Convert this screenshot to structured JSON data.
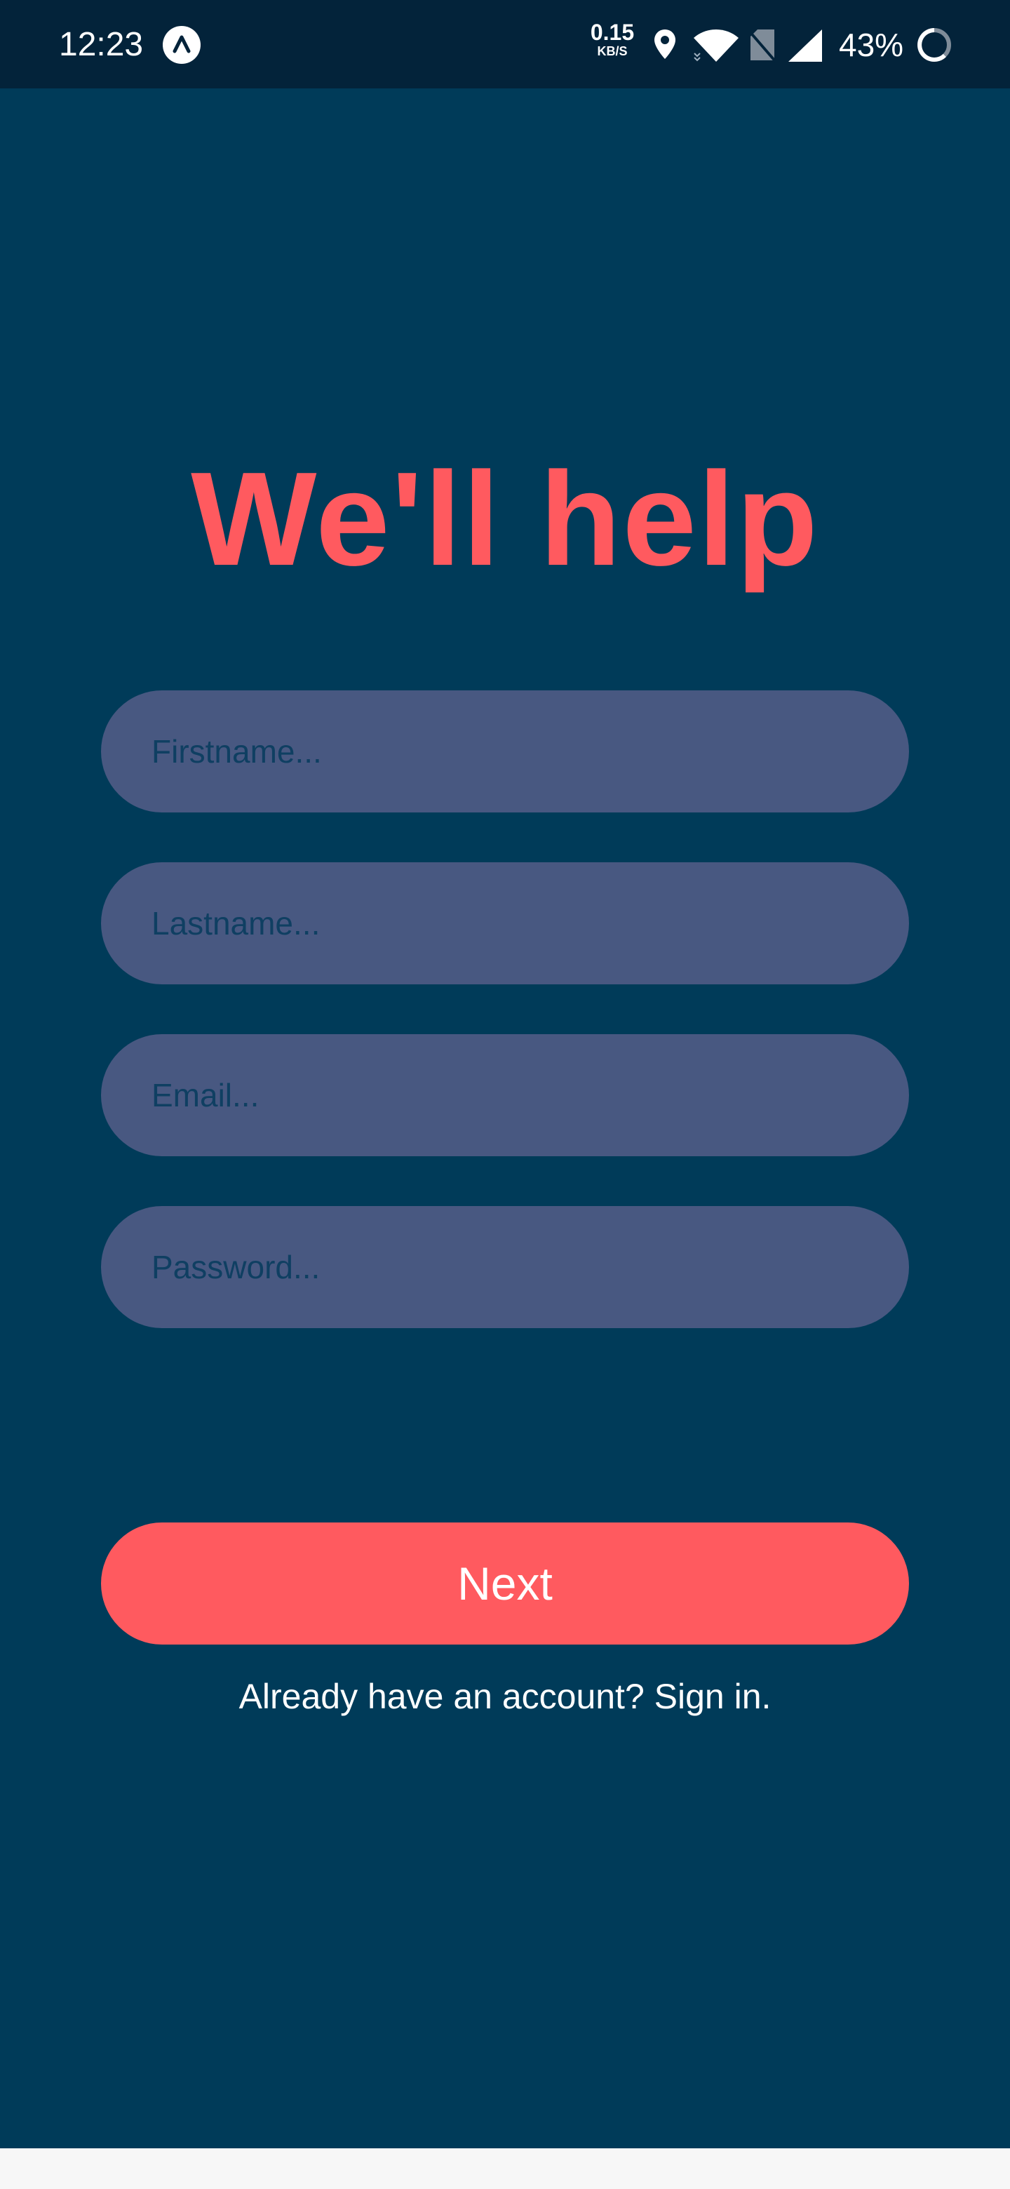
{
  "status_bar": {
    "time": "12:23",
    "net_speed_value": "0.15",
    "net_speed_unit": "KB/S",
    "battery_percent": "43%",
    "icons": [
      "app-notification-icon",
      "location-icon",
      "wifi-icon",
      "no-sim-icon",
      "cell-signal-icon",
      "battery-icon"
    ]
  },
  "signup": {
    "title": "We'll help",
    "fields": {
      "firstname_placeholder": "Firstname...",
      "lastname_placeholder": "Lastname...",
      "email_placeholder": "Email...",
      "password_placeholder": "Password..."
    },
    "next_label": "Next",
    "signin_text": "Already have an account? Sign in."
  },
  "colors": {
    "background": "#003b59",
    "accent": "#ff5a5f",
    "field_background": "#485881",
    "status_bar": "#03233a"
  }
}
